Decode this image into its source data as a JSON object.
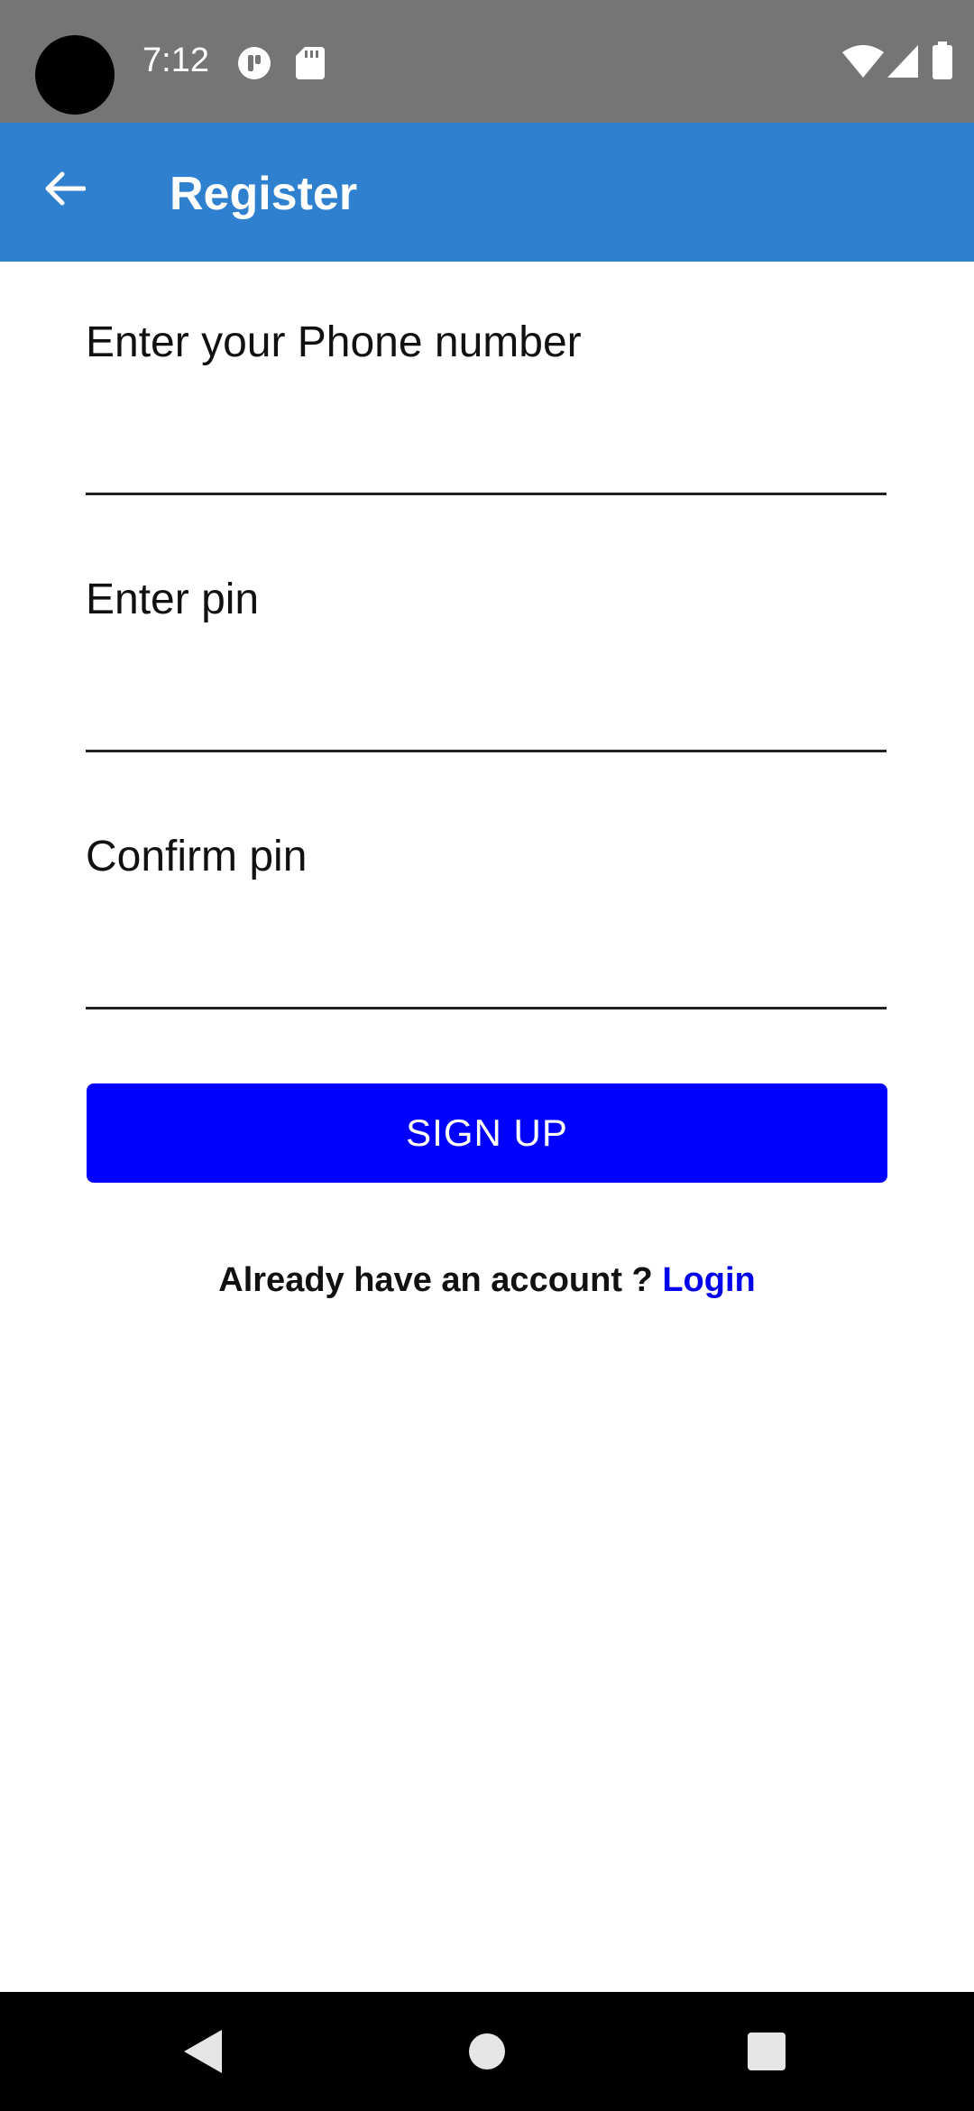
{
  "status_bar": {
    "time": "7:12",
    "left_icons": [
      "camera-cutout",
      "podcast-app-icon",
      "sd-card-icon"
    ],
    "right_icons": [
      "wifi-icon",
      "cellular-signal-icon",
      "battery-icon"
    ]
  },
  "app_bar": {
    "title": "Register",
    "background": "#3080d0",
    "back_icon": "arrow-back-icon"
  },
  "form": {
    "phone": {
      "label": "Enter your Phone number",
      "value": "",
      "placeholder": ""
    },
    "pin": {
      "label": "Enter pin",
      "value": "",
      "placeholder": ""
    },
    "confirm_pin": {
      "label": "Confirm pin",
      "value": "",
      "placeholder": ""
    },
    "signup_label": "SIGN UP",
    "signup_color": "#0000ff"
  },
  "footer": {
    "prompt": "Already have an account ?",
    "login_label": "Login",
    "login_color": "#0000ee"
  },
  "nav_bar": {
    "icons": [
      "nav-back-icon",
      "nav-home-icon",
      "nav-recents-icon"
    ]
  }
}
